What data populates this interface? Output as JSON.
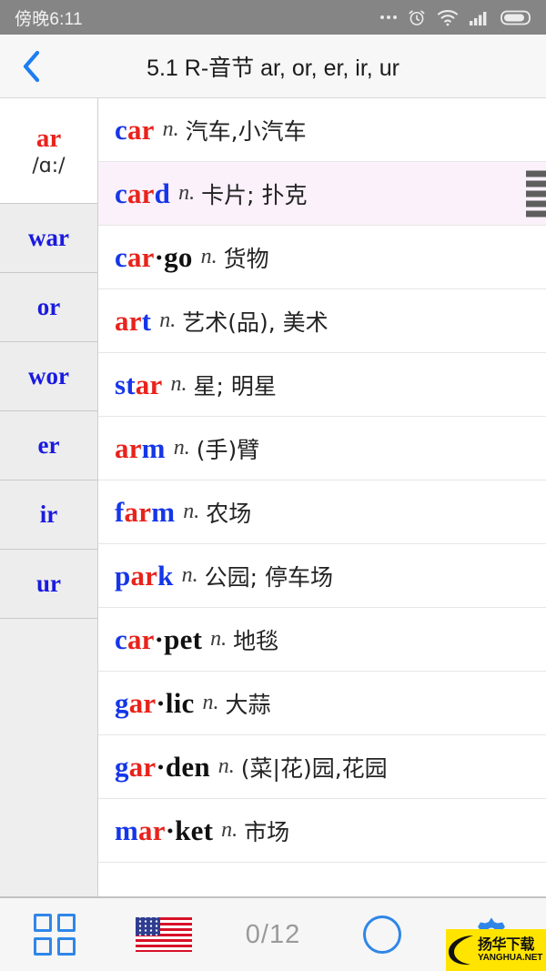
{
  "statusbar": {
    "time": "傍晚6:11",
    "icons": [
      "more-dots-icon",
      "alarm-clock-icon",
      "wifi-icon",
      "signal-bars-icon",
      "battery-icon"
    ]
  },
  "header": {
    "back_icon": "chevron-left-icon",
    "title": "5.1 R-音节 ar, or, er, ir, ur"
  },
  "sidebar": {
    "items": [
      {
        "key": "ar",
        "ipa": "/ɑ:/",
        "selected": true
      },
      {
        "key": "war",
        "ipa": "",
        "selected": false
      },
      {
        "key": "or",
        "ipa": "",
        "selected": false
      },
      {
        "key": "wor",
        "ipa": "",
        "selected": false
      },
      {
        "key": "er",
        "ipa": "",
        "selected": false
      },
      {
        "key": "ir",
        "ipa": "",
        "selected": false
      },
      {
        "key": "ur",
        "ipa": "",
        "selected": false
      }
    ]
  },
  "list": {
    "rows": [
      {
        "word": "car",
        "parts": [
          {
            "t": "c",
            "c": "b"
          },
          {
            "t": "ar",
            "c": "r"
          }
        ],
        "pos": "n.",
        "gloss": "汽车,小汽车",
        "selected": false
      },
      {
        "word": "card",
        "parts": [
          {
            "t": "c",
            "c": "b"
          },
          {
            "t": "ar",
            "c": "r"
          },
          {
            "t": "d",
            "c": "b"
          }
        ],
        "pos": "n.",
        "gloss": "卡片; 扑克",
        "selected": true
      },
      {
        "word": "car·go",
        "parts": [
          {
            "t": "c",
            "c": "b"
          },
          {
            "t": "ar",
            "c": "r"
          },
          {
            "t": "·go",
            "c": "k"
          }
        ],
        "pos": "n.",
        "gloss": "货物",
        "selected": false
      },
      {
        "word": "art",
        "parts": [
          {
            "t": "ar",
            "c": "r"
          },
          {
            "t": "t",
            "c": "b"
          }
        ],
        "pos": "n.",
        "gloss": "艺术(品), 美术",
        "selected": false
      },
      {
        "word": "star",
        "parts": [
          {
            "t": "st",
            "c": "b"
          },
          {
            "t": "ar",
            "c": "r"
          }
        ],
        "pos": "n.",
        "gloss": "星; 明星",
        "selected": false
      },
      {
        "word": "arm",
        "parts": [
          {
            "t": "ar",
            "c": "r"
          },
          {
            "t": "m",
            "c": "b"
          }
        ],
        "pos": "n.",
        "gloss": "(手)臂",
        "selected": false
      },
      {
        "word": "farm",
        "parts": [
          {
            "t": "f",
            "c": "b"
          },
          {
            "t": "ar",
            "c": "r"
          },
          {
            "t": "m",
            "c": "b"
          }
        ],
        "pos": "n.",
        "gloss": "农场",
        "selected": false
      },
      {
        "word": "park",
        "parts": [
          {
            "t": "p",
            "c": "b"
          },
          {
            "t": "ar",
            "c": "r"
          },
          {
            "t": "k",
            "c": "b"
          }
        ],
        "pos": "n.",
        "gloss": "公园; 停车场",
        "selected": false
      },
      {
        "word": "car·pet",
        "parts": [
          {
            "t": "c",
            "c": "b"
          },
          {
            "t": "ar",
            "c": "r"
          },
          {
            "t": "·pet",
            "c": "k"
          }
        ],
        "pos": "n.",
        "gloss": "地毯",
        "selected": false
      },
      {
        "word": "gar·lic",
        "parts": [
          {
            "t": "g",
            "c": "b"
          },
          {
            "t": "ar",
            "c": "r"
          },
          {
            "t": "·lic",
            "c": "k"
          }
        ],
        "pos": "n.",
        "gloss": "大蒜",
        "selected": false
      },
      {
        "word": "gar·den",
        "parts": [
          {
            "t": "g",
            "c": "b"
          },
          {
            "t": "ar",
            "c": "r"
          },
          {
            "t": "·den",
            "c": "k"
          }
        ],
        "pos": "n.",
        "gloss": "(菜|花)园,花园",
        "selected": false
      },
      {
        "word": "mar·ket",
        "parts": [
          {
            "t": "m",
            "c": "b"
          },
          {
            "t": "ar",
            "c": "r"
          },
          {
            "t": "·ket",
            "c": "k"
          }
        ],
        "pos": "n.",
        "gloss": "市场",
        "selected": false
      }
    ],
    "selected_row_handle_icon": "list-handle-icon"
  },
  "bottombar": {
    "grid_icon": "grid-view-icon",
    "flag_icon": "us-flag-icon",
    "counter": "0/12",
    "circle_icon": "circle-outline-icon",
    "gear_icon": "gear-icon"
  },
  "watermark": {
    "cn": "扬华下载",
    "en": "YANGHUA.NET"
  },
  "colors": {
    "accent_blue": "#1536e8",
    "accent_red": "#e8231c",
    "ui_blue": "#2f86e8",
    "statusbar_bg": "#858585",
    "selected_row_bg": "#faf1fa",
    "watermark_bg": "#ffe400"
  }
}
